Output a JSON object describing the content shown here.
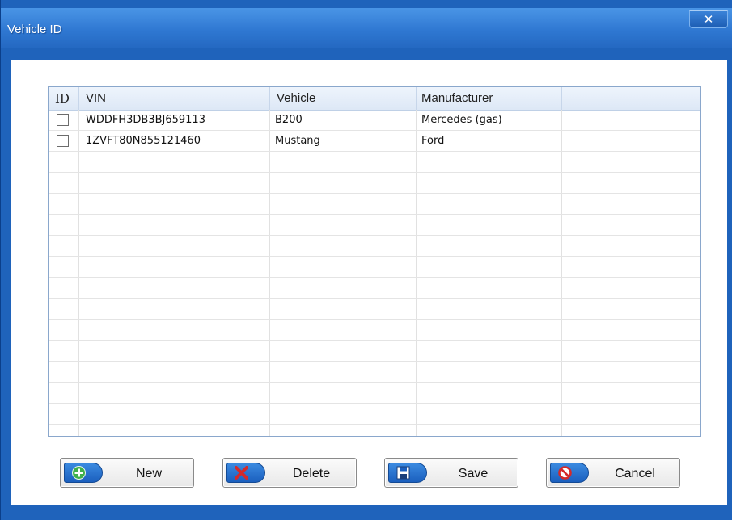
{
  "window": {
    "title": "Vehicle ID",
    "close_symbol": "✕"
  },
  "table": {
    "headers": [
      "ID",
      "VIN",
      "Vehicle",
      "Manufacturer"
    ],
    "rows": [
      {
        "vin": "WDDFH3DB3BJ659113",
        "vehicle": "B200",
        "manufacturer": "Mercedes (gas)",
        "checked": false
      },
      {
        "vin": "1ZVFT80N855121460",
        "vehicle": "Mustang",
        "manufacturer": "Ford",
        "checked": false
      }
    ]
  },
  "buttons": {
    "new": {
      "label": "New",
      "icon": "plus-icon",
      "icon_color": "#3fb04a"
    },
    "delete": {
      "label": "Delete",
      "icon": "delete-x-icon",
      "icon_color": "#d42a2a"
    },
    "save": {
      "label": "Save",
      "icon": "floppy-disk-icon",
      "icon_color": "#ffffff"
    },
    "cancel": {
      "label": "Cancel",
      "icon": "no-entry-icon",
      "icon_color": "#d42a2a"
    }
  },
  "colors": {
    "titlebar": "#2f78d2",
    "frame": "#1f63bb",
    "icon_pill": "#1b5fbe"
  }
}
